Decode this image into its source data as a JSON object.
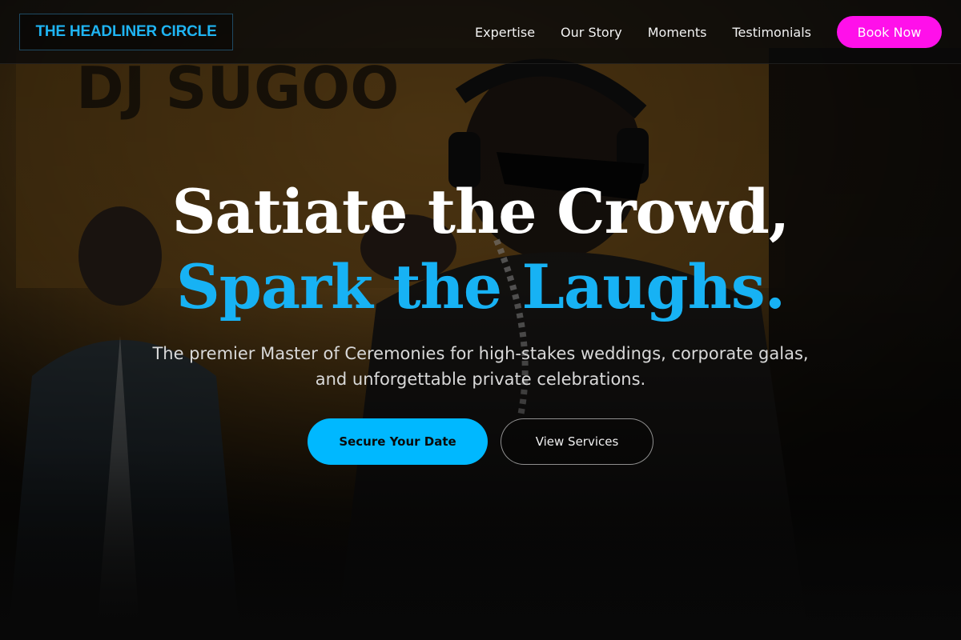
{
  "brand": {
    "logo_text": "THE HEADLINER CIRCLE",
    "accent_color": "#17b2f4",
    "cta_color": "#ff10ea"
  },
  "nav": {
    "links": [
      {
        "label": "Expertise"
      },
      {
        "label": "Our Story"
      },
      {
        "label": "Moments"
      },
      {
        "label": "Testimonials"
      }
    ],
    "book_label": "Book Now"
  },
  "hero": {
    "headline_line1": "Satiate the Crowd,",
    "headline_line2": "Spark the Laughs.",
    "subtitle": "The premier Master of Ceremonies for high-stakes weddings, corporate galas, and unforgettable private celebrations.",
    "primary_cta": "Secure Your Date",
    "secondary_cta": "View Services",
    "background_image": "performer-with-headphones-and-sunglasses-photo"
  }
}
